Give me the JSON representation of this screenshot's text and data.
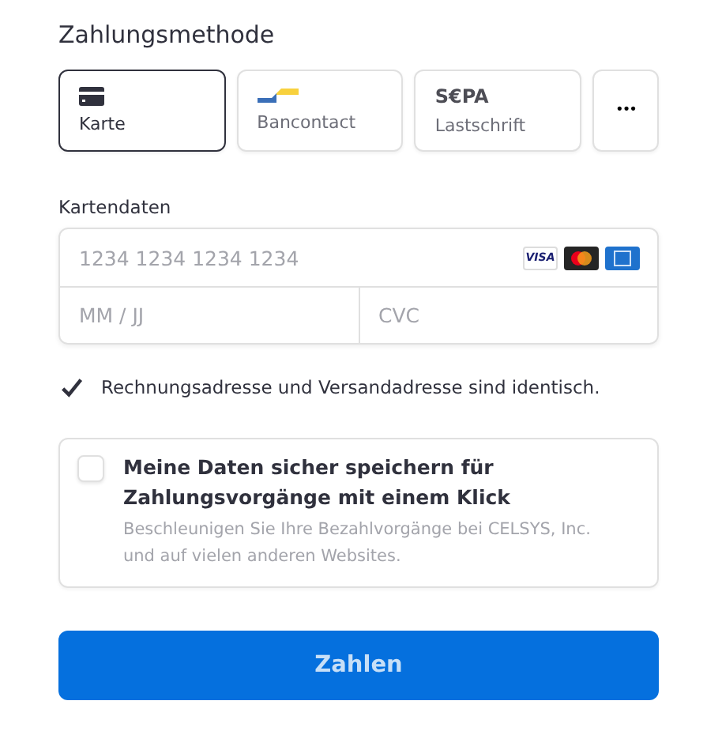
{
  "title": "Zahlungsmethode",
  "methods": [
    {
      "kind": "card",
      "label": "Karte",
      "selected": true
    },
    {
      "kind": "bancontact",
      "label": "Bancontact",
      "selected": false
    },
    {
      "kind": "sepa",
      "logo": "S€PA",
      "label": "Lastschrift",
      "selected": false
    },
    {
      "kind": "more",
      "label": "•••",
      "selected": false
    }
  ],
  "card_section": {
    "label": "Kartendaten",
    "number_placeholder": "1234 1234 1234 1234",
    "visa": "VISA",
    "expiry_placeholder": "MM / JJ",
    "cvc_placeholder": "CVC"
  },
  "same_address": {
    "label": "Rechnungsadresse und Versandadresse sind identisch.",
    "checked": true
  },
  "save_details": {
    "title": "Meine Daten sicher speichern für Zahlungsvorgänge mit einem Klick",
    "description": "Beschleunigen Sie Ihre Bezahlvorgänge bei CELSYS, Inc. und auf vielen anderen Websites.",
    "checked": false
  },
  "pay_button": "Zahlen"
}
